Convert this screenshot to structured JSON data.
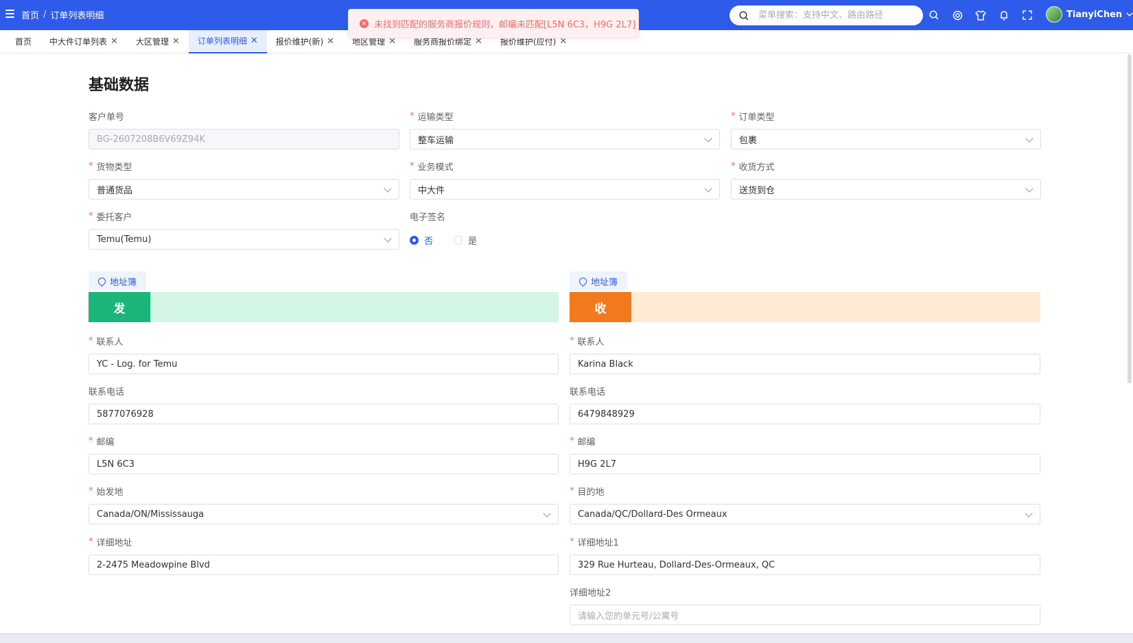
{
  "header": {
    "breadcrumb": [
      "首页",
      "订单列表明细"
    ],
    "breadcrumb_sep": "/",
    "search_placeholder": "菜单搜索：支持中文、路由路径",
    "user_name": "TianyiChen"
  },
  "toast": {
    "type": "error",
    "message": "未找到匹配的服务商报价规则，邮编未匹配[L5N 6C3，H9G 2L7]"
  },
  "tabs": [
    {
      "label": "首页",
      "closable": false,
      "active": false
    },
    {
      "label": "中大件订单列表",
      "closable": true,
      "active": false
    },
    {
      "label": "大区管理",
      "closable": true,
      "active": false
    },
    {
      "label": "订单列表明细",
      "closable": true,
      "active": true
    },
    {
      "label": "报价维护(新)",
      "closable": true,
      "active": false
    },
    {
      "label": "地区管理",
      "closable": true,
      "active": false
    },
    {
      "label": "服务商报价绑定",
      "closable": true,
      "active": false
    },
    {
      "label": "报价维护(应付)",
      "closable": true,
      "active": false
    }
  ],
  "basic": {
    "title": "基础数据",
    "customer_no": {
      "label": "客户单号",
      "value": "BG-2607208B6V69Z94K"
    },
    "transport_type": {
      "label": "运输类型",
      "value": "整车运输"
    },
    "order_type": {
      "label": "订单类型",
      "value": "包裹"
    },
    "cargo_type": {
      "label": "货物类型",
      "value": "普通货品"
    },
    "business_mode": {
      "label": "业务模式",
      "value": "中大件"
    },
    "receive_method": {
      "label": "收货方式",
      "value": "送货到仓"
    },
    "client": {
      "label": "委托客户",
      "value": "Temu(Temu)"
    },
    "esign": {
      "label": "电子签名",
      "options": [
        "否",
        "是"
      ],
      "selected": "否"
    }
  },
  "sender": {
    "addrbook": "地址簿",
    "badge": "发",
    "contact": {
      "label": "联系人",
      "value": "YC - Log. for Temu"
    },
    "phone": {
      "label": "联系电话",
      "value": "5877076928"
    },
    "postcode": {
      "label": "邮编",
      "value": "L5N 6C3"
    },
    "origin": {
      "label": "始发地",
      "value": "Canada/ON/Mississauga"
    },
    "address": {
      "label": "详细地址",
      "value": "2-2475 Meadowpine Blvd"
    }
  },
  "receiver": {
    "addrbook": "地址簿",
    "badge": "收",
    "contact": {
      "label": "联系人",
      "value": "Karina Black"
    },
    "phone": {
      "label": "联系电话",
      "value": "6479848929"
    },
    "postcode": {
      "label": "邮编",
      "value": "H9G 2L7"
    },
    "destination": {
      "label": "目的地",
      "value": "Canada/QC/Dollard-Des Ormeaux"
    },
    "address1": {
      "label": "详细地址1",
      "value": "329 Rue Hurteau, Dollard-Des-Ormeaux, QC"
    },
    "address2": {
      "label": "详细地址2",
      "placeholder": "请输入您的单元号/公寓号"
    }
  },
  "colors": {
    "primary": "#2f5bea",
    "sender_badge": "#1bb57a",
    "sender_bar": "#d3f6e5",
    "receiver_badge": "#f27a1c",
    "receiver_bar": "#ffead4",
    "error": "#f56c6c"
  }
}
